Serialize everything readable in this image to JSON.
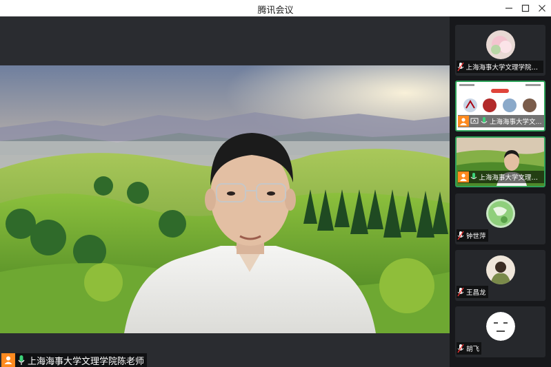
{
  "window": {
    "title": "腾讯会议"
  },
  "main_video": {
    "speaker_name": "上海海事大学文理学院陈老师",
    "host_icon": "user-host-icon",
    "mic_icon": "mic-active-icon"
  },
  "participants": [
    {
      "name": "上海海事大学文理学院李萍",
      "mic": "muted",
      "avatar": "flower-avatar"
    },
    {
      "name": "上海海事大学文...",
      "mic": "active",
      "host": true,
      "sharing": true,
      "content": "screen-share"
    },
    {
      "name": "上海海事大学文理学...",
      "mic": "active",
      "host": true,
      "content": "camera-video"
    },
    {
      "name": "钟世萍",
      "mic": "muted",
      "avatar": "globe-avatar"
    },
    {
      "name": "王昌龙",
      "mic": "muted",
      "avatar": "person-avatar"
    },
    {
      "name": "胡飞",
      "mic": "muted",
      "avatar": "face-avatar"
    }
  ],
  "colors": {
    "accent_green": "#2ea35a",
    "host_orange": "#ff8a1f",
    "background": "#2a2c30",
    "sidebar": "#17181b"
  }
}
